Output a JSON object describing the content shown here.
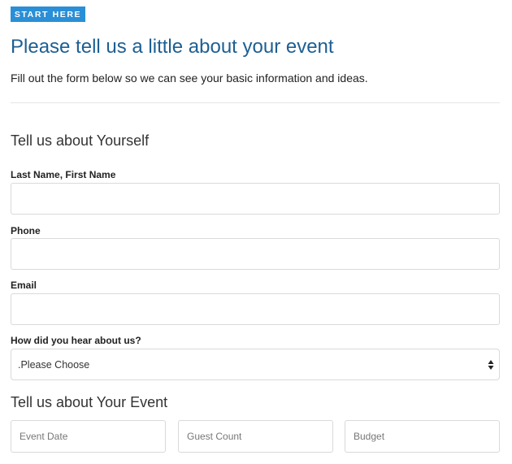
{
  "badge": {
    "label": "START HERE"
  },
  "header": {
    "title": "Please tell us a little about your event",
    "intro": "Fill out the form below so we can see your basic information and ideas."
  },
  "section_yourself": {
    "heading": "Tell us about Yourself",
    "name_label": "Last Name,  First Name",
    "name_value": "",
    "phone_label": "Phone",
    "phone_value": "",
    "email_label": "Email",
    "email_value": "",
    "referral_label": "How did you hear about us?",
    "referral_selected": ".Please Choose"
  },
  "section_event": {
    "heading": "Tell us about Your Event",
    "event_date_placeholder": "Event Date",
    "guest_count_placeholder": "Guest Count",
    "budget_placeholder": "Budget"
  },
  "colors": {
    "accent": "#2a8fd6",
    "title": "#1d5f93",
    "border": "#d9d9d9"
  }
}
